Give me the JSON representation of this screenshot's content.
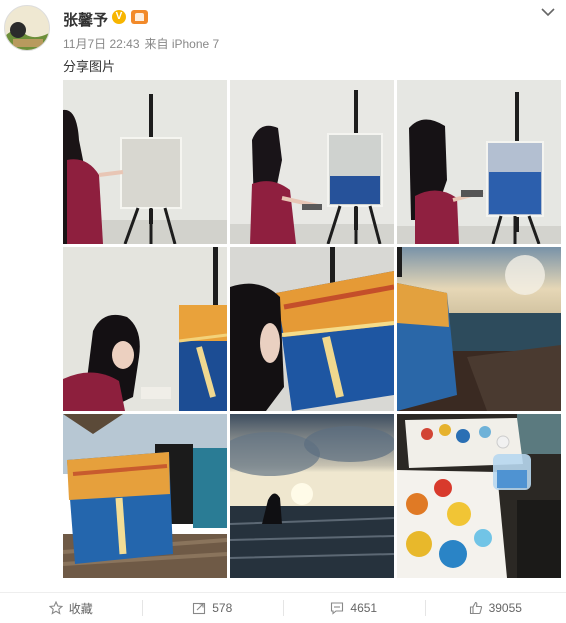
{
  "post": {
    "author": "张馨予",
    "time": "11月7日 22:43",
    "source": "来自 iPhone 7",
    "text": "分享图片"
  },
  "icons": {
    "verified": "v-badge-icon",
    "level": "vip-crown-icon",
    "menu": "chevron-down-icon"
  },
  "actions": {
    "favorite_label": "收藏",
    "repost_count": "578",
    "comment_count": "4651",
    "like_count": "39055"
  },
  "colors": {
    "verified": "#f7b500",
    "level": "#f28a2a"
  }
}
